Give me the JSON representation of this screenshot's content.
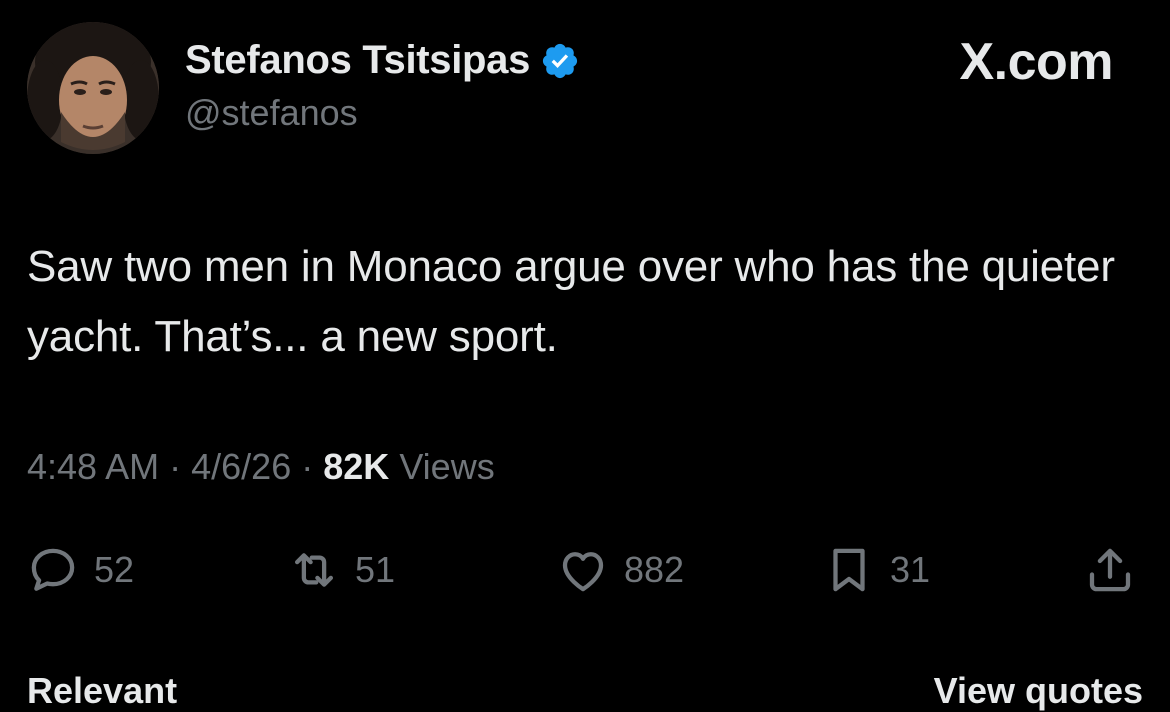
{
  "author": {
    "display_name": "Stefanos Tsitsipas",
    "handle": "@stefanos",
    "verified": true
  },
  "brand": "X.com",
  "tweet": {
    "text": "Saw two men in Monaco argue over who has the quieter yacht. That’s... a new sport."
  },
  "meta": {
    "time": "4:48 AM",
    "separator": "·",
    "date": "4/6/26",
    "views_count": "82K",
    "views_label": "Views"
  },
  "actions": {
    "replies": "52",
    "reposts": "51",
    "likes": "882",
    "bookmarks": "31"
  },
  "footer": {
    "left": "Relevant",
    "right": "View quotes"
  },
  "colors": {
    "background": "#000000",
    "text": "#e7e9ea",
    "secondary": "#71767b",
    "verified_badge": "#1d9bf0"
  },
  "icons": [
    "avatar",
    "verified-badge-icon",
    "reply-icon",
    "repost-icon",
    "like-icon",
    "bookmark-icon",
    "share-icon"
  ]
}
